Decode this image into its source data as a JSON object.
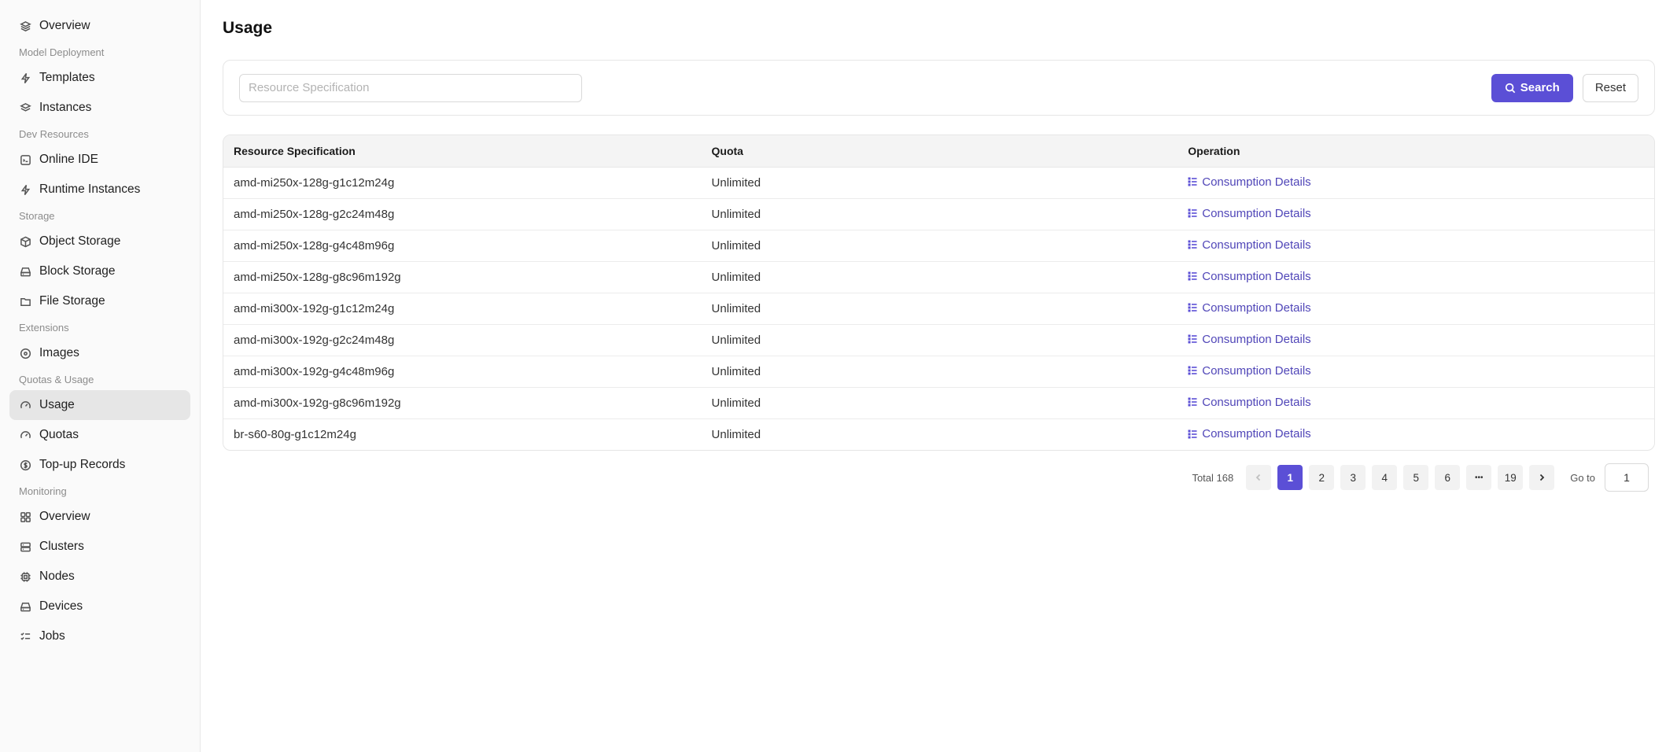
{
  "sidebar": {
    "items": [
      {
        "type": "item",
        "label": "Overview",
        "icon": "layers-icon",
        "name": "sidebar-item-overview"
      },
      {
        "type": "group",
        "label": "Model Deployment"
      },
      {
        "type": "item",
        "label": "Templates",
        "icon": "bolt-icon",
        "name": "sidebar-item-templates"
      },
      {
        "type": "item",
        "label": "Instances",
        "icon": "stack-icon",
        "name": "sidebar-item-instances"
      },
      {
        "type": "group",
        "label": "Dev Resources"
      },
      {
        "type": "item",
        "label": "Online IDE",
        "icon": "code-window-icon",
        "name": "sidebar-item-online-ide"
      },
      {
        "type": "item",
        "label": "Runtime Instances",
        "icon": "bolt-icon",
        "name": "sidebar-item-runtime-instances"
      },
      {
        "type": "group",
        "label": "Storage"
      },
      {
        "type": "item",
        "label": "Object Storage",
        "icon": "cube-icon",
        "name": "sidebar-item-object-storage"
      },
      {
        "type": "item",
        "label": "Block Storage",
        "icon": "drive-icon",
        "name": "sidebar-item-block-storage"
      },
      {
        "type": "item",
        "label": "File Storage",
        "icon": "folder-icon",
        "name": "sidebar-item-file-storage"
      },
      {
        "type": "group",
        "label": "Extensions"
      },
      {
        "type": "item",
        "label": "Images",
        "icon": "disc-icon",
        "name": "sidebar-item-images"
      },
      {
        "type": "group",
        "label": "Quotas & Usage"
      },
      {
        "type": "item",
        "label": "Usage",
        "icon": "gauge-icon",
        "name": "sidebar-item-usage",
        "active": true
      },
      {
        "type": "item",
        "label": "Quotas",
        "icon": "gauge-icon",
        "name": "sidebar-item-quotas"
      },
      {
        "type": "item",
        "label": "Top-up Records",
        "icon": "coin-icon",
        "name": "sidebar-item-top-up-records"
      },
      {
        "type": "group",
        "label": "Monitoring"
      },
      {
        "type": "item",
        "label": "Overview",
        "icon": "dashboard-icon",
        "name": "sidebar-item-monitoring-overview"
      },
      {
        "type": "item",
        "label": "Clusters",
        "icon": "server-icon",
        "name": "sidebar-item-clusters"
      },
      {
        "type": "item",
        "label": "Nodes",
        "icon": "chip-icon",
        "name": "sidebar-item-nodes"
      },
      {
        "type": "item",
        "label": "Devices",
        "icon": "drive-icon",
        "name": "sidebar-item-devices"
      },
      {
        "type": "item",
        "label": "Jobs",
        "icon": "checklist-icon",
        "name": "sidebar-item-jobs"
      }
    ]
  },
  "page": {
    "title": "Usage"
  },
  "filter": {
    "placeholder": "Resource Specification",
    "value": "",
    "search_label": "Search",
    "reset_label": "Reset"
  },
  "table": {
    "columns": [
      "Resource Specification",
      "Quota",
      "Operation"
    ],
    "op_label": "Consumption Details",
    "rows": [
      {
        "spec": "amd-mi250x-128g-g1c12m24g",
        "quota": "Unlimited"
      },
      {
        "spec": "amd-mi250x-128g-g2c24m48g",
        "quota": "Unlimited"
      },
      {
        "spec": "amd-mi250x-128g-g4c48m96g",
        "quota": "Unlimited"
      },
      {
        "spec": "amd-mi250x-128g-g8c96m192g",
        "quota": "Unlimited"
      },
      {
        "spec": "amd-mi300x-192g-g1c12m24g",
        "quota": "Unlimited"
      },
      {
        "spec": "amd-mi300x-192g-g2c24m48g",
        "quota": "Unlimited"
      },
      {
        "spec": "amd-mi300x-192g-g4c48m96g",
        "quota": "Unlimited"
      },
      {
        "spec": "amd-mi300x-192g-g8c96m192g",
        "quota": "Unlimited"
      },
      {
        "spec": "br-s60-80g-g1c12m24g",
        "quota": "Unlimited"
      }
    ]
  },
  "pagination": {
    "total_label": "Total 168",
    "pages": [
      "1",
      "2",
      "3",
      "4",
      "5",
      "6",
      "•••",
      "19"
    ],
    "current": "1",
    "goto_label": "Go to",
    "goto_value": "1"
  },
  "colors": {
    "accent": "#5b4fd6",
    "link": "#5046b8"
  }
}
